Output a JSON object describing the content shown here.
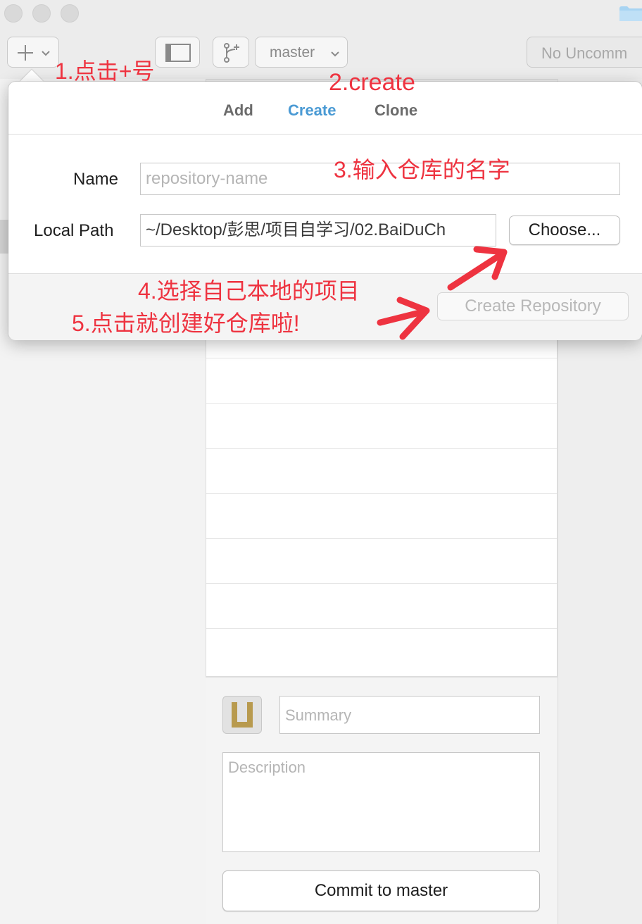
{
  "toolbar": {
    "branch_name": "master",
    "status_button": "No Uncomm"
  },
  "popover": {
    "tabs": [
      "Add",
      "Create",
      "Clone"
    ],
    "active_tab": "Create",
    "name_label": "Name",
    "name_placeholder": "repository-name",
    "local_path_label": "Local Path",
    "local_path_value": "~/Desktop/彭思/项目自学习/02.BaiDuCh",
    "choose_button": "Choose...",
    "create_button": "Create Repository"
  },
  "commit": {
    "summary_placeholder": "Summary",
    "description_placeholder": "Description",
    "commit_button": "Commit to master"
  },
  "annotations": {
    "step1": "1.点击+号",
    "step2": "2.create",
    "step3": "3.输入仓库的名字",
    "step4": "4.选择自己本地的项目",
    "step5": "5.点击就创建好仓库啦!"
  },
  "colors": {
    "accent_tab": "#4a9ad4",
    "annotation": "#ee3340",
    "avatar": "#b89a4e"
  }
}
